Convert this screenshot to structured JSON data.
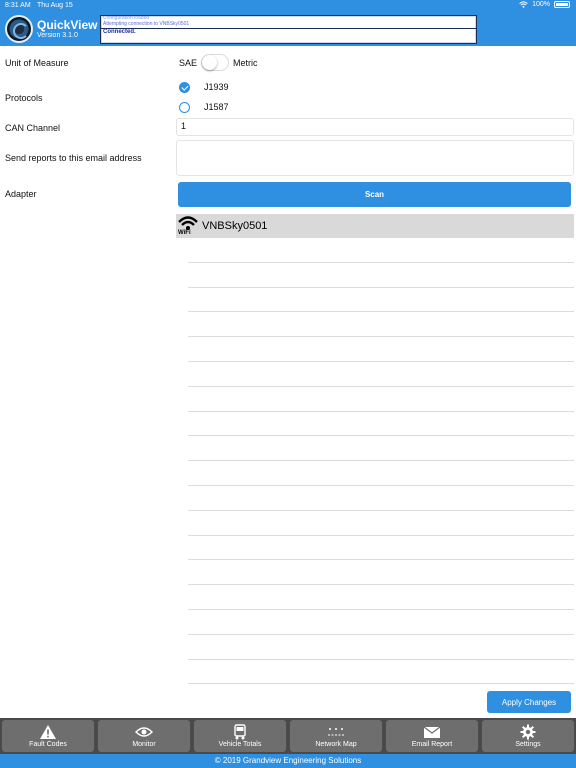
{
  "status_bar": {
    "time": "8:31 AM",
    "date": "Thu Aug 15",
    "battery": "100%"
  },
  "header": {
    "app_name": "QuickView",
    "version": "Version 3.1.0",
    "log": {
      "lines": [
        "Configuration loaded",
        "Attempting connection to VNBSky0501"
      ],
      "status": "Connected."
    }
  },
  "form": {
    "unit_label": "Unit of Measure",
    "unit_option_left": "SAE",
    "unit_option_right": "Metric",
    "protocols_label": "Protocols",
    "protocols": [
      {
        "label": "J1939",
        "checked": true
      },
      {
        "label": "J1587",
        "checked": false
      }
    ],
    "can_label": "CAN Channel",
    "can_value": "1",
    "email_label": "Send reports to this email address",
    "email_value": "",
    "adapter_label": "Adapter",
    "scan_label": "Scan",
    "adapter_device": {
      "icon": "wifi-icon",
      "icon_label": "WiFi",
      "name": "VNBSky0501"
    },
    "apply_label": "Apply Changes"
  },
  "tabs": [
    {
      "label": "Fault Codes",
      "icon": "warning-icon"
    },
    {
      "label": "Monitor",
      "icon": "eye-icon"
    },
    {
      "label": "Vehicle Totals",
      "icon": "truck-icon"
    },
    {
      "label": "Network Map",
      "icon": "network-icon"
    },
    {
      "label": "Email Report",
      "icon": "envelope-icon"
    },
    {
      "label": "Settings",
      "icon": "gear-icon"
    }
  ],
  "footer": "© 2019 Grandview Engineering Solutions",
  "colors": {
    "accent": "#2f8fe0",
    "tabbar": "#4a4a4a",
    "tab": "#6e6e6e",
    "row_highlight": "#d9d9d9"
  }
}
